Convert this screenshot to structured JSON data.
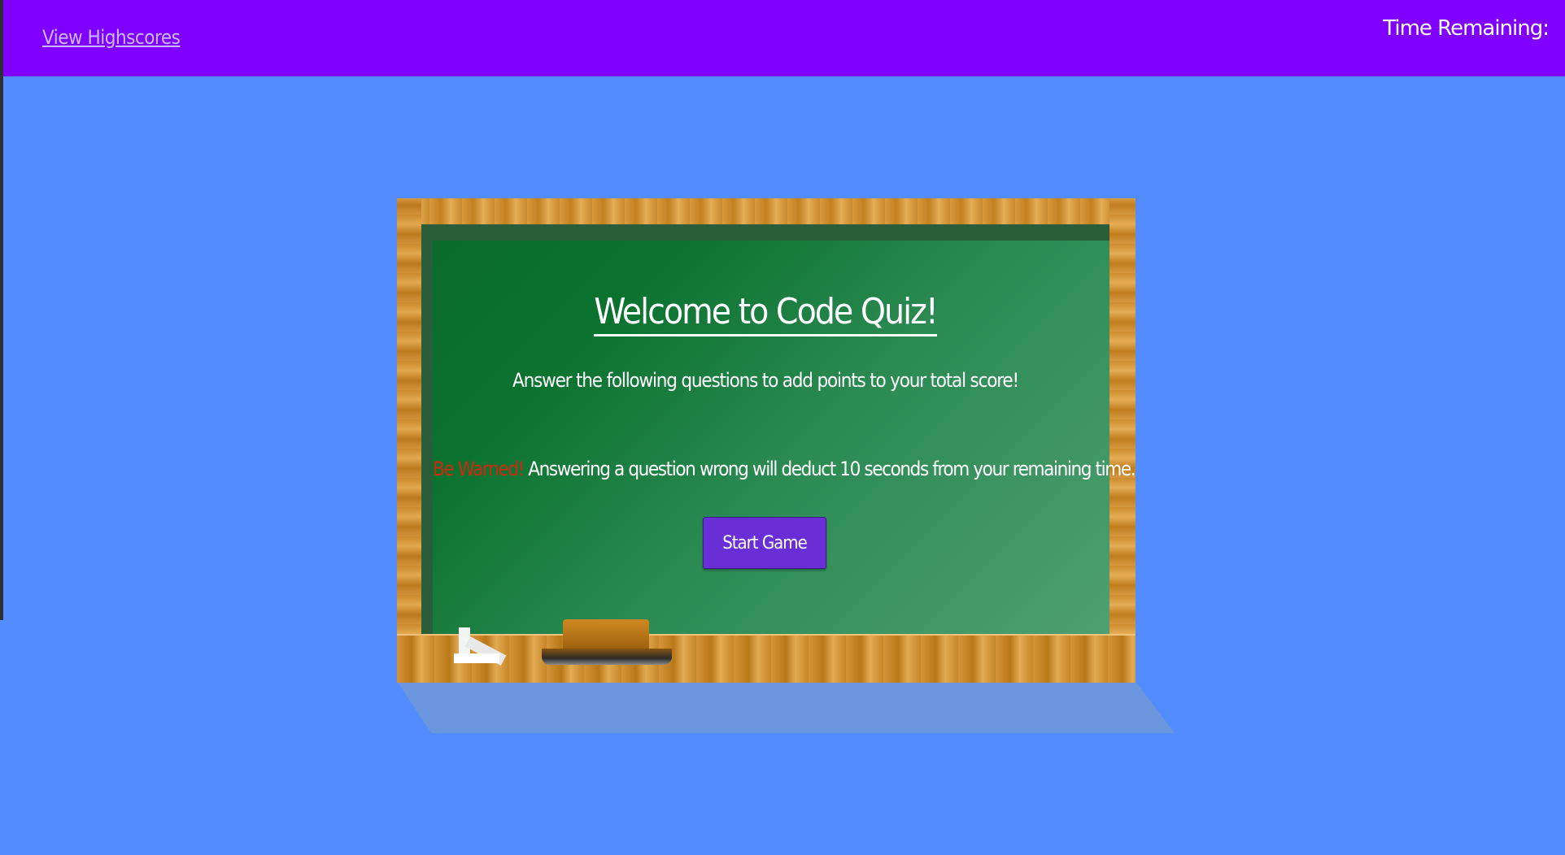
{
  "header": {
    "highscores_link": "View Highscores",
    "timer_label": "Time Remaining:"
  },
  "board": {
    "title": "Welcome to Code Quiz!",
    "subtitle": "Answer the following questions to add points to your total score!",
    "warning_prefix": "Be Warned!",
    "warning_text": " Answering a question wrong will deduct 10 seconds from your remaining time.",
    "start_button": "Start Game"
  },
  "colors": {
    "header": "#7f00ff",
    "background": "#538cff",
    "button": "#6a2ed6",
    "warning": "#cc2a10"
  }
}
